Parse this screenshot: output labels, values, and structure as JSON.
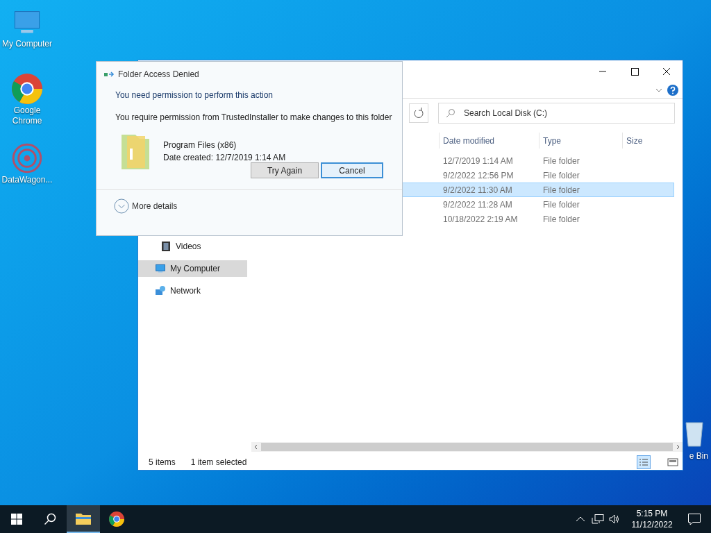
{
  "desktop_icons": [
    {
      "label": "My Computer",
      "kind": "computer"
    },
    {
      "label": "Google Chrome",
      "kind": "browser"
    },
    {
      "label": "DataWagon...",
      "kind": "app"
    },
    {
      "label": "e Bin",
      "kind": "trash"
    }
  ],
  "explorer": {
    "search": {
      "placeholder": "Search Local Disk (C:)"
    },
    "nav": [
      {
        "label": "Videos",
        "kind": "video",
        "selected": false
      },
      {
        "label": "My Computer",
        "kind": "computer",
        "selected": true
      },
      {
        "label": "Network",
        "kind": "network",
        "selected": false
      }
    ],
    "columns": [
      "Date modified",
      "Type",
      "Size"
    ],
    "rows": [
      {
        "date": "12/7/2019 1:14 AM",
        "type": "File folder",
        "selected": false
      },
      {
        "date": "9/2/2022 12:56 PM",
        "type": "File folder",
        "selected": false
      },
      {
        "date": "9/2/2022 11:30 AM",
        "type": "File folder",
        "selected": true
      },
      {
        "date": "9/2/2022 11:28 AM",
        "type": "File folder",
        "selected": false
      },
      {
        "date": "10/18/2022 2:19 AM",
        "type": "File folder",
        "selected": false
      }
    ],
    "status": {
      "count": "5 items",
      "selection": "1 item selected"
    }
  },
  "dialog": {
    "title": "Folder Access Denied",
    "message": "You need permission to perform this action",
    "detail": "You require permission from TrustedInstaller to make changes to this folder",
    "file_name": "Program Files (x86)",
    "file_date": "Date created: 12/7/2019 1:14 AM",
    "buttons": [
      {
        "label": "Try Again",
        "focused": false
      },
      {
        "label": "Cancel",
        "focused": true
      }
    ],
    "more_details": "More details"
  },
  "taskbar": {
    "apps": [
      {
        "kind": "explorer",
        "active": true
      },
      {
        "kind": "browser",
        "active": false
      }
    ],
    "time": "5:15 PM",
    "date": "11/12/2022"
  }
}
